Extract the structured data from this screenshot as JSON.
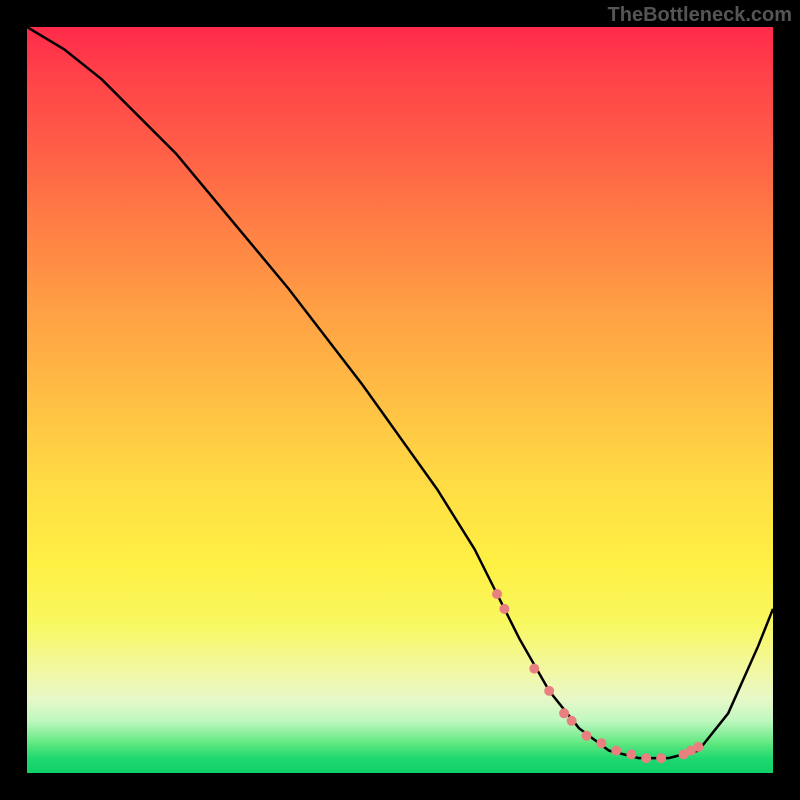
{
  "watermark": "TheBottleneck.com",
  "chart_data": {
    "type": "line",
    "title": "",
    "xlabel": "",
    "ylabel": "",
    "xlim": [
      0,
      100
    ],
    "ylim": [
      0,
      100
    ],
    "series": [
      {
        "name": "curve",
        "color": "#000000",
        "x": [
          0,
          5,
          10,
          15,
          20,
          25,
          30,
          35,
          40,
          45,
          50,
          55,
          60,
          63,
          66,
          70,
          74,
          78,
          82,
          86,
          90,
          94,
          98,
          100
        ],
        "y": [
          100,
          97,
          93,
          88,
          83,
          77,
          71,
          65,
          58.5,
          52,
          45,
          38,
          30,
          24,
          18,
          11,
          6,
          3,
          2,
          2,
          3,
          8,
          17,
          22
        ]
      }
    ],
    "markers": {
      "name": "highlight-dots",
      "color": "#e98080",
      "x": [
        63,
        64,
        68,
        70,
        72,
        73,
        75,
        77,
        79,
        81,
        83,
        85,
        88,
        89,
        90
      ],
      "y": [
        24,
        22,
        14,
        11,
        8,
        7,
        5,
        4,
        3,
        2.5,
        2,
        2,
        2.5,
        3,
        3.5
      ]
    }
  }
}
